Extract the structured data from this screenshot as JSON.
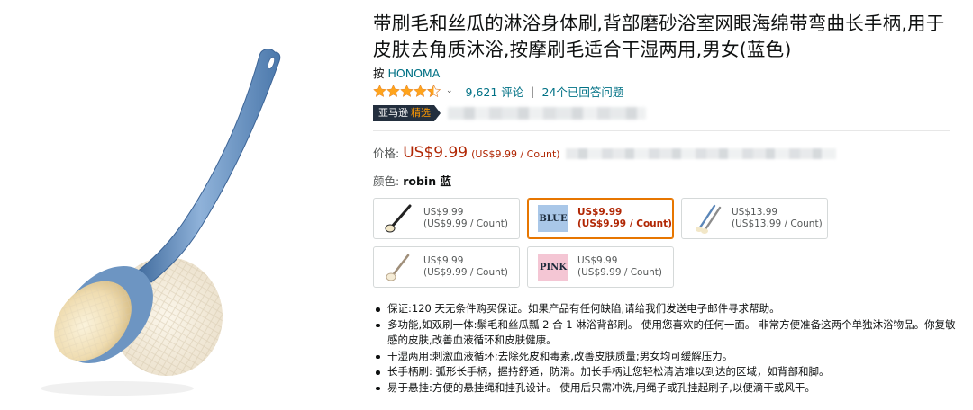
{
  "product": {
    "title": "带刷毛和丝瓜的淋浴身体刷,背部磨砂浴室网眼海绵带弯曲长手柄,用于皮肤去角质沐浴,按摩刷毛适合干湿两用,男女(蓝色)",
    "by_label": "按",
    "brand": "HONOMA",
    "rating": 4.5,
    "reviews_text": "9,621 评论",
    "answered_text": "24个已回答问题",
    "badge_prefix": "亚马逊",
    "badge_choice": "精选"
  },
  "price": {
    "label": "价格:",
    "value": "US$9.99",
    "unit": "(US$9.99 / Count)"
  },
  "color": {
    "label": "颜色:",
    "selected": "robin 蓝"
  },
  "swatches": [
    {
      "thumb": "brush-white",
      "price": "US$9.99",
      "unit": "(US$9.99 / Count)",
      "selected": false
    },
    {
      "thumb": "word",
      "word": "BLUE",
      "bg": "#a9c7e8",
      "price": "US$9.99",
      "unit": "(US$9.99 / Count)",
      "selected": true
    },
    {
      "thumb": "brush-pair",
      "price": "US$13.99",
      "unit": "(US$13.99 / Count)",
      "selected": false
    },
    {
      "thumb": "brush-beige",
      "price": "US$9.99",
      "unit": "(US$9.99 / Count)",
      "selected": false
    },
    {
      "thumb": "word",
      "word": "PINK",
      "bg": "#f4c6d4",
      "price": "US$9.99",
      "unit": "(US$9.99 / Count)",
      "selected": false
    }
  ],
  "bullets": [
    "保证:120 天无条件购买保证。如果产品有任何缺陷,请给我们发送电子邮件寻求帮助。",
    "多功能,如双刷一体:鬃毛和丝瓜瓢 2 合 1 淋浴背部刷。 使用您喜欢的任何一面。 非常方便准备这两个单独沐浴物品。你复敏感的皮肤,改善血液循环和皮肤健康。",
    "干湿两用:刺激血液循环;去除死皮和毒素,改善皮肤质量;男女均可缓解压力。",
    "长手柄刷: 弧形长手柄，握持舒适，防滑。加长手柄让您轻松清洁难以到达的区域，如背部和脚。",
    "易于悬挂:方便的悬挂绳和挂孔设计。 使用后只需冲洗,用绳子或孔挂起刷子,以便滴干或风干。"
  ],
  "colors": {
    "link": "#007185",
    "price": "#b12704",
    "badge_bg": "#232f3e",
    "badge_accent": "#ff9900",
    "star": "#ffa41c",
    "selected_border": "#e77600",
    "handle": "#5b86b8"
  }
}
